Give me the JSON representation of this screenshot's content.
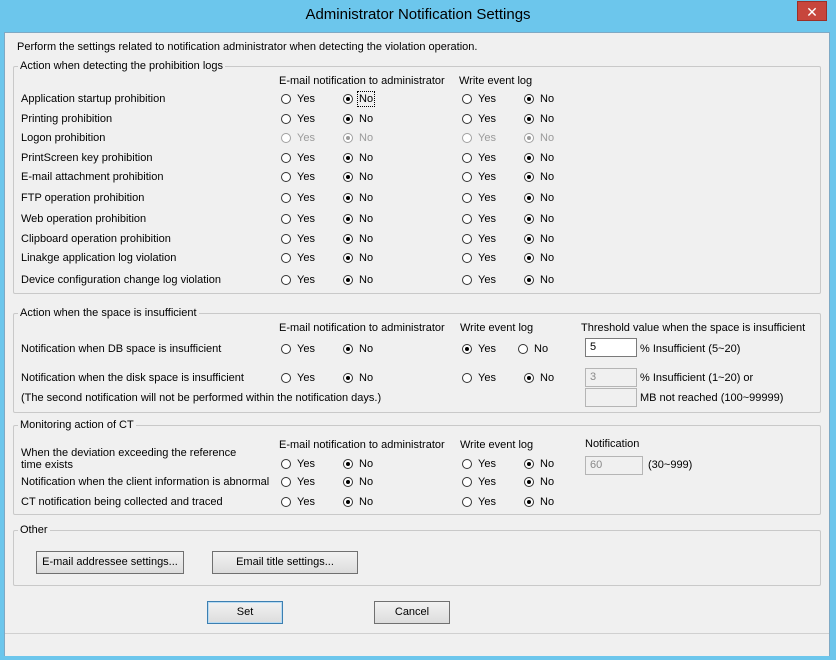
{
  "window": {
    "title": "Administrator Notification Settings",
    "close_glyph": "✕"
  },
  "intro": "Perform the settings related to notification administrator when detecting the violation operation.",
  "prohibition": {
    "legend": "Action when detecting the prohibition logs",
    "col_email": "E-mail notification to administrator",
    "col_event": "Write event log",
    "rows": [
      {
        "label": "Application startup prohibition",
        "email": "no",
        "event": "no",
        "disabled": false
      },
      {
        "label": "Printing prohibition",
        "email": "no",
        "event": "no",
        "disabled": false
      },
      {
        "label": "Logon prohibition",
        "email": "no",
        "event": "no",
        "disabled": true
      },
      {
        "label": "PrintScreen key prohibition",
        "email": "no",
        "event": "no",
        "disabled": false
      },
      {
        "label": "E-mail attachment prohibition",
        "email": "no",
        "event": "no",
        "disabled": false
      },
      {
        "label": "FTP operation prohibition",
        "email": "no",
        "event": "no",
        "disabled": false
      },
      {
        "label": "Web operation prohibition",
        "email": "no",
        "event": "no",
        "disabled": false
      },
      {
        "label": "Clipboard operation prohibition",
        "email": "no",
        "event": "no",
        "disabled": false
      },
      {
        "label": "Linakge application log violation",
        "email": "no",
        "event": "no",
        "disabled": false
      },
      {
        "label": "Device configuration change log violation",
        "email": "no",
        "event": "no",
        "disabled": false
      }
    ]
  },
  "space": {
    "legend": "Action when the space is insufficient",
    "col_email": "E-mail notification to administrator",
    "col_event": "Write event log",
    "col_threshold": "Threshold value when the space is insufficient",
    "db_label": "Notification when DB space is insufficient",
    "db_email": "no",
    "db_event": "yes",
    "db_value": "5",
    "db_suffix": "% Insufficient (5~20)",
    "disk_label": "Notification when the disk space is insufficient",
    "disk_email": "no",
    "disk_event": "no",
    "disk_value": "3",
    "disk_suffix": "% Insufficient (1~20) or",
    "mb_value": "",
    "mb_suffix": "MB not reached (100~99999)",
    "note": "(The second notification will not be performed within the notification days.)"
  },
  "ct": {
    "legend": "Monitoring action of CT",
    "col_email": "E-mail notification to administrator",
    "col_event": "Write event log",
    "col_notification": "Notification",
    "notif_value": "60",
    "notif_range": "(30~999)",
    "rows": [
      {
        "label_line1": "When the deviation exceeding the reference",
        "label_line2": "time exists",
        "email": "no",
        "event": "no"
      },
      {
        "label_line1": "Notification when the client information is abnormal",
        "label_line2": "",
        "email": "no",
        "event": "no"
      },
      {
        "label_line1": "CT notification being collected and traced",
        "label_line2": "",
        "email": "no",
        "event": "no"
      }
    ]
  },
  "other": {
    "legend": "Other",
    "addressee_button": "E-mail addressee settings...",
    "title_button": "Email title settings..."
  },
  "footer": {
    "set": "Set",
    "cancel": "Cancel"
  },
  "radio_labels": {
    "yes": "Yes",
    "no": "No"
  }
}
